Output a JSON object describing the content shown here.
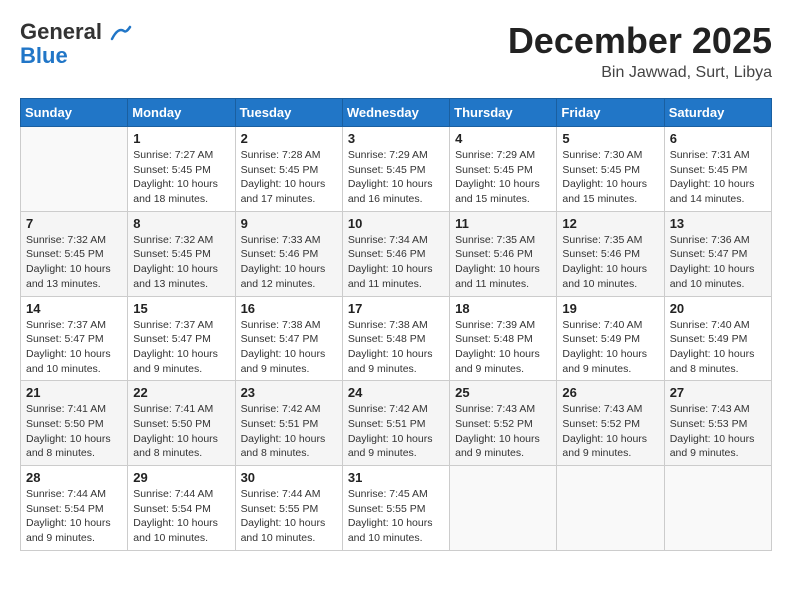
{
  "header": {
    "logo_line1": "General",
    "logo_line2": "Blue",
    "month": "December 2025",
    "location": "Bin Jawwad, Surt, Libya"
  },
  "days_of_week": [
    "Sunday",
    "Monday",
    "Tuesday",
    "Wednesday",
    "Thursday",
    "Friday",
    "Saturday"
  ],
  "weeks": [
    [
      {
        "day": "",
        "info": ""
      },
      {
        "day": "1",
        "info": "Sunrise: 7:27 AM\nSunset: 5:45 PM\nDaylight: 10 hours\nand 18 minutes."
      },
      {
        "day": "2",
        "info": "Sunrise: 7:28 AM\nSunset: 5:45 PM\nDaylight: 10 hours\nand 17 minutes."
      },
      {
        "day": "3",
        "info": "Sunrise: 7:29 AM\nSunset: 5:45 PM\nDaylight: 10 hours\nand 16 minutes."
      },
      {
        "day": "4",
        "info": "Sunrise: 7:29 AM\nSunset: 5:45 PM\nDaylight: 10 hours\nand 15 minutes."
      },
      {
        "day": "5",
        "info": "Sunrise: 7:30 AM\nSunset: 5:45 PM\nDaylight: 10 hours\nand 15 minutes."
      },
      {
        "day": "6",
        "info": "Sunrise: 7:31 AM\nSunset: 5:45 PM\nDaylight: 10 hours\nand 14 minutes."
      }
    ],
    [
      {
        "day": "7",
        "info": "Sunrise: 7:32 AM\nSunset: 5:45 PM\nDaylight: 10 hours\nand 13 minutes."
      },
      {
        "day": "8",
        "info": "Sunrise: 7:32 AM\nSunset: 5:45 PM\nDaylight: 10 hours\nand 13 minutes."
      },
      {
        "day": "9",
        "info": "Sunrise: 7:33 AM\nSunset: 5:46 PM\nDaylight: 10 hours\nand 12 minutes."
      },
      {
        "day": "10",
        "info": "Sunrise: 7:34 AM\nSunset: 5:46 PM\nDaylight: 10 hours\nand 11 minutes."
      },
      {
        "day": "11",
        "info": "Sunrise: 7:35 AM\nSunset: 5:46 PM\nDaylight: 10 hours\nand 11 minutes."
      },
      {
        "day": "12",
        "info": "Sunrise: 7:35 AM\nSunset: 5:46 PM\nDaylight: 10 hours\nand 10 minutes."
      },
      {
        "day": "13",
        "info": "Sunrise: 7:36 AM\nSunset: 5:47 PM\nDaylight: 10 hours\nand 10 minutes."
      }
    ],
    [
      {
        "day": "14",
        "info": "Sunrise: 7:37 AM\nSunset: 5:47 PM\nDaylight: 10 hours\nand 10 minutes."
      },
      {
        "day": "15",
        "info": "Sunrise: 7:37 AM\nSunset: 5:47 PM\nDaylight: 10 hours\nand 9 minutes."
      },
      {
        "day": "16",
        "info": "Sunrise: 7:38 AM\nSunset: 5:47 PM\nDaylight: 10 hours\nand 9 minutes."
      },
      {
        "day": "17",
        "info": "Sunrise: 7:38 AM\nSunset: 5:48 PM\nDaylight: 10 hours\nand 9 minutes."
      },
      {
        "day": "18",
        "info": "Sunrise: 7:39 AM\nSunset: 5:48 PM\nDaylight: 10 hours\nand 9 minutes."
      },
      {
        "day": "19",
        "info": "Sunrise: 7:40 AM\nSunset: 5:49 PM\nDaylight: 10 hours\nand 9 minutes."
      },
      {
        "day": "20",
        "info": "Sunrise: 7:40 AM\nSunset: 5:49 PM\nDaylight: 10 hours\nand 8 minutes."
      }
    ],
    [
      {
        "day": "21",
        "info": "Sunrise: 7:41 AM\nSunset: 5:50 PM\nDaylight: 10 hours\nand 8 minutes."
      },
      {
        "day": "22",
        "info": "Sunrise: 7:41 AM\nSunset: 5:50 PM\nDaylight: 10 hours\nand 8 minutes."
      },
      {
        "day": "23",
        "info": "Sunrise: 7:42 AM\nSunset: 5:51 PM\nDaylight: 10 hours\nand 8 minutes."
      },
      {
        "day": "24",
        "info": "Sunrise: 7:42 AM\nSunset: 5:51 PM\nDaylight: 10 hours\nand 9 minutes."
      },
      {
        "day": "25",
        "info": "Sunrise: 7:43 AM\nSunset: 5:52 PM\nDaylight: 10 hours\nand 9 minutes."
      },
      {
        "day": "26",
        "info": "Sunrise: 7:43 AM\nSunset: 5:52 PM\nDaylight: 10 hours\nand 9 minutes."
      },
      {
        "day": "27",
        "info": "Sunrise: 7:43 AM\nSunset: 5:53 PM\nDaylight: 10 hours\nand 9 minutes."
      }
    ],
    [
      {
        "day": "28",
        "info": "Sunrise: 7:44 AM\nSunset: 5:54 PM\nDaylight: 10 hours\nand 9 minutes."
      },
      {
        "day": "29",
        "info": "Sunrise: 7:44 AM\nSunset: 5:54 PM\nDaylight: 10 hours\nand 10 minutes."
      },
      {
        "day": "30",
        "info": "Sunrise: 7:44 AM\nSunset: 5:55 PM\nDaylight: 10 hours\nand 10 minutes."
      },
      {
        "day": "31",
        "info": "Sunrise: 7:45 AM\nSunset: 5:55 PM\nDaylight: 10 hours\nand 10 minutes."
      },
      {
        "day": "",
        "info": ""
      },
      {
        "day": "",
        "info": ""
      },
      {
        "day": "",
        "info": ""
      }
    ]
  ]
}
